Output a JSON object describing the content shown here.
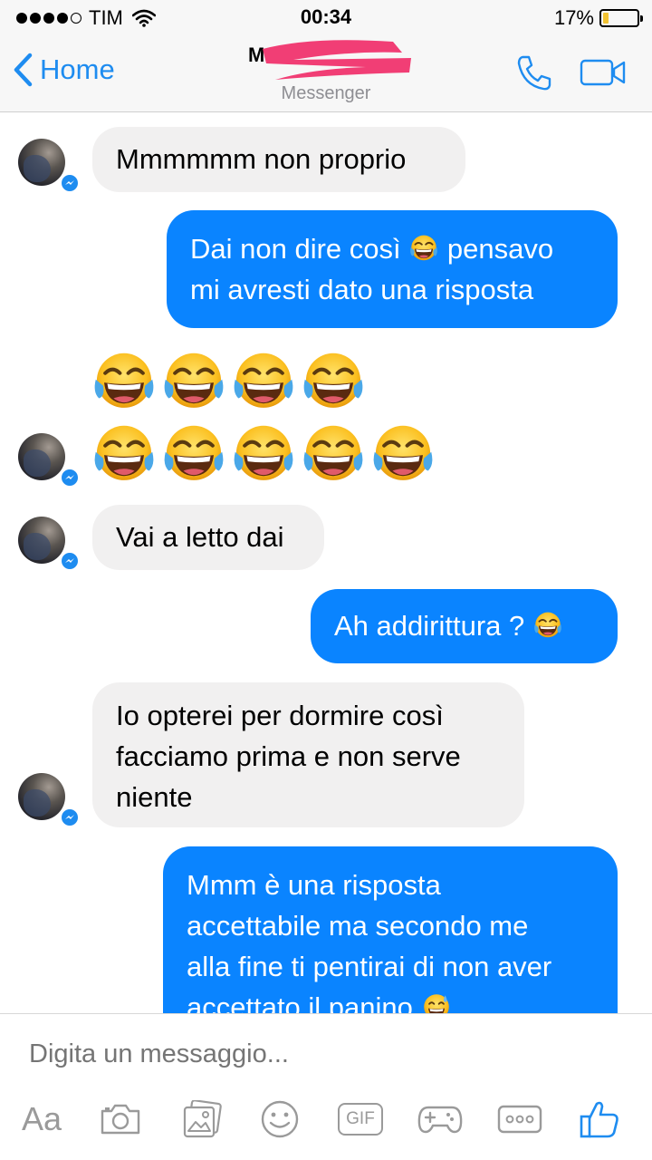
{
  "status_bar": {
    "carrier": "TIM",
    "time": "00:34",
    "battery_percent": "17%",
    "battery_level": 0.17,
    "signal_bars_filled": 4,
    "signal_bars_total": 5
  },
  "nav": {
    "back_label": "Home",
    "contact_name": "M",
    "subtitle": "Messenger",
    "accent_color": "#1e8cf0"
  },
  "messages": [
    {
      "direction": "incoming",
      "lines": [
        "Mmmmmm non proprio"
      ]
    },
    {
      "direction": "outgoing",
      "lines": [
        "Dai non dire così",
        "pensavo",
        "mi avresti dato una risposta"
      ],
      "emoji": "face-with-tears-of-joy"
    },
    {
      "direction": "incoming",
      "type": "emoji-only",
      "emoji": "face-with-tears-of-joy",
      "count_row1": 4,
      "count_row2": 5
    },
    {
      "direction": "incoming",
      "lines": [
        "Vai a letto dai"
      ]
    },
    {
      "direction": "outgoing",
      "lines": [
        "Ah addirittura ?"
      ],
      "emoji": "face-with-tears-of-joy"
    },
    {
      "direction": "incoming",
      "lines": [
        "Io opterei per dormire così",
        "facciamo prima e non serve",
        "niente"
      ]
    },
    {
      "direction": "outgoing",
      "lines": [
        "Mmm è una risposta",
        "accettabile ma secondo me",
        "alla fine ti pentirai di non aver",
        "accettato il panino"
      ],
      "emoji": "grinning-face-with-sweat"
    }
  ],
  "composer": {
    "placeholder": "Digita un messaggio...",
    "aa_label": "Aa",
    "gif_label": "GIF"
  },
  "toolbar_icons": [
    "aa-text-icon",
    "camera-icon",
    "photo-gallery-icon",
    "smiley-icon",
    "gif-icon",
    "gamepad-icon",
    "more-icon",
    "thumbs-up-icon"
  ],
  "colors": {
    "outgoing_bubble": "#0a84ff",
    "incoming_bubble": "#f1f0f0",
    "messenger_blue": "#1e8cf0"
  }
}
